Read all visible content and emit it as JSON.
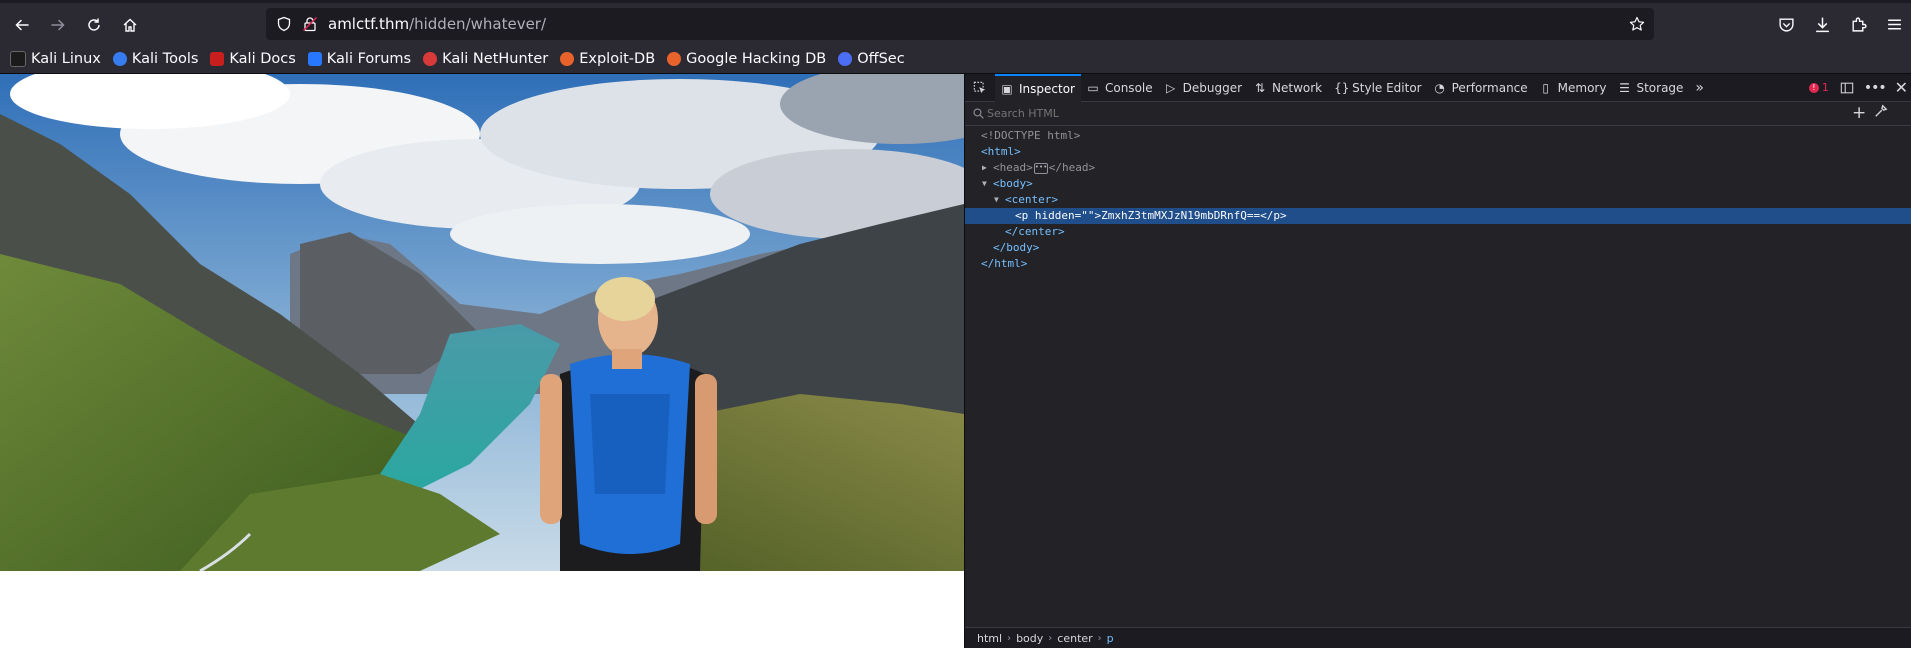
{
  "browser": {
    "url_host": "amlctf.thm",
    "url_path": "/hidden/whatever/"
  },
  "bookmarks": [
    {
      "label": "Kali Linux",
      "icon": "kali-dragon-icon",
      "color": "#1b1b1b"
    },
    {
      "label": "Kali Tools",
      "icon": "kali-tools-icon",
      "color": "#367bf0"
    },
    {
      "label": "Kali Docs",
      "icon": "kali-docs-icon",
      "color": "#c81e1e"
    },
    {
      "label": "Kali Forums",
      "icon": "kali-forums-icon",
      "color": "#2777ff"
    },
    {
      "label": "Kali NetHunter",
      "icon": "kali-nethunter-icon",
      "color": "#d83a3a"
    },
    {
      "label": "Exploit-DB",
      "icon": "exploit-db-icon",
      "color": "#e8632b"
    },
    {
      "label": "Google Hacking DB",
      "icon": "ghdb-icon",
      "color": "#e8632b"
    },
    {
      "label": "OffSec",
      "icon": "offsec-icon",
      "color": "#4c6ef5"
    }
  ],
  "devtools": {
    "tabs": [
      {
        "label": "Inspector",
        "icon": "inspector-icon",
        "active": true
      },
      {
        "label": "Console",
        "icon": "console-icon"
      },
      {
        "label": "Debugger",
        "icon": "debugger-icon"
      },
      {
        "label": "Network",
        "icon": "network-icon"
      },
      {
        "label": "Style Editor",
        "icon": "style-editor-icon"
      },
      {
        "label": "Performance",
        "icon": "performance-icon"
      },
      {
        "label": "Memory",
        "icon": "memory-icon"
      },
      {
        "label": "Storage",
        "icon": "storage-icon"
      }
    ],
    "error_count": "1",
    "search_placeholder": "Search HTML",
    "markup": {
      "doctype": "<!DOCTYPE html>",
      "html_open": "<html>",
      "head_open": "<head>",
      "head_close": "</head>",
      "body_open": "<body>",
      "center_open": "<center>",
      "p_open_start": "<p ",
      "p_attr_name": "hidden",
      "p_attr_eq": "=\"",
      "p_attr_close": "\">",
      "p_text": "ZmxhZ3tmMXJzN19mbDRnfQ==",
      "p_close": "</p>",
      "center_close": "</center>",
      "body_close": "</body>",
      "html_close": "</html>"
    },
    "breadcrumbs": [
      "html",
      "body",
      "center",
      "p"
    ]
  }
}
